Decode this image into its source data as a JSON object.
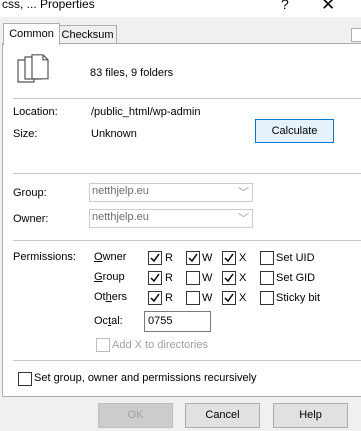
{
  "window": {
    "title": "css, ... Properties",
    "help_glyph": "?",
    "close_glyph": "✕"
  },
  "tabs": [
    {
      "label": "Common",
      "active": true
    },
    {
      "label": "Checksum",
      "active": false
    }
  ],
  "summary": {
    "text": "83 files, 9 folders",
    "icon": "files-icon"
  },
  "info": {
    "location_label": "Location:",
    "location_value": "/public_html/wp-admin",
    "size_label": "Size:",
    "size_value": "Unknown",
    "calculate_label": "Calculate"
  },
  "ownership": {
    "group_label": "Group:",
    "group_value": "netthjelp.eu",
    "owner_label": "Owner:",
    "owner_value": "netthjelp.eu"
  },
  "permissions": {
    "label": "Permissions:",
    "rows": [
      {
        "name_pre": "",
        "name_key": "O",
        "name_post": "wner",
        "r": true,
        "w": true,
        "x": true,
        "special": "Set UID",
        "special_checked": false
      },
      {
        "name_pre": "",
        "name_key": "G",
        "name_post": "roup",
        "r": true,
        "w": false,
        "x": true,
        "special": "Set GID",
        "special_checked": false
      },
      {
        "name_pre": "Ot",
        "name_key": "h",
        "name_post": "ers",
        "r": true,
        "w": false,
        "x": true,
        "special": "Sticky bit",
        "special_checked": false
      }
    ],
    "r_label": "R",
    "w_label": "W",
    "x_label": "X",
    "octal_label_pre": "Oc",
    "octal_label_key": "t",
    "octal_label_post": "al:",
    "octal_value": "0755",
    "add_x_label": "Add X to directories"
  },
  "recursive_label": "Set group, owner and permissions recursively",
  "buttons": {
    "ok": "OK",
    "cancel": "Cancel",
    "help": "Help"
  }
}
